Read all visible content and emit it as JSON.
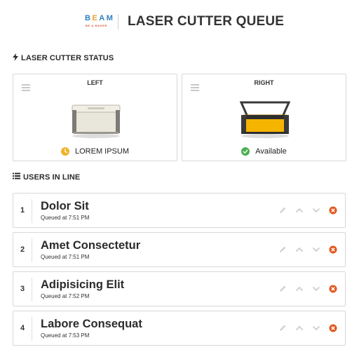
{
  "header": {
    "logo_text": "BEAM",
    "logo_tagline": "BE A MAKER",
    "title": "LASER CUTTER QUEUE"
  },
  "status_section": {
    "heading": "LASER CUTTER STATUS",
    "icon": "bolt-icon",
    "cutters": [
      {
        "name": "LEFT",
        "status": "LOREM IPSUM",
        "status_icon": "clock-icon",
        "status_color": "#f0b429",
        "machine_color": "#e9e6dc"
      },
      {
        "name": "RIGHT",
        "status": "Available",
        "status_icon": "check-circle-icon",
        "status_color": "#4caf50",
        "machine_color": "#f5b400"
      }
    ]
  },
  "queue_section": {
    "heading": "USERS IN LINE",
    "icon": "list-icon",
    "entries": [
      {
        "position": "1",
        "name": "Dolor Sit",
        "queued": "Queued at 7:51 PM"
      },
      {
        "position": "2",
        "name": "Amet Consectetur",
        "queued": "Queued at 7:51 PM"
      },
      {
        "position": "3",
        "name": "Adipisicing Elit",
        "queued": "Queued at 7:52 PM"
      },
      {
        "position": "4",
        "name": "Labore Consequat",
        "queued": "Queued at 7:53 PM"
      }
    ],
    "actions": [
      "pencil-icon",
      "chevron-up-icon",
      "chevron-down-icon",
      "remove-circle-icon"
    ]
  },
  "colors": {
    "brand_blue": "#2f80c0",
    "brand_orange": "#e8a13a",
    "remove_red": "#e2571e",
    "action_gray": "#cfcfcf",
    "border": "#d8d8d8"
  }
}
